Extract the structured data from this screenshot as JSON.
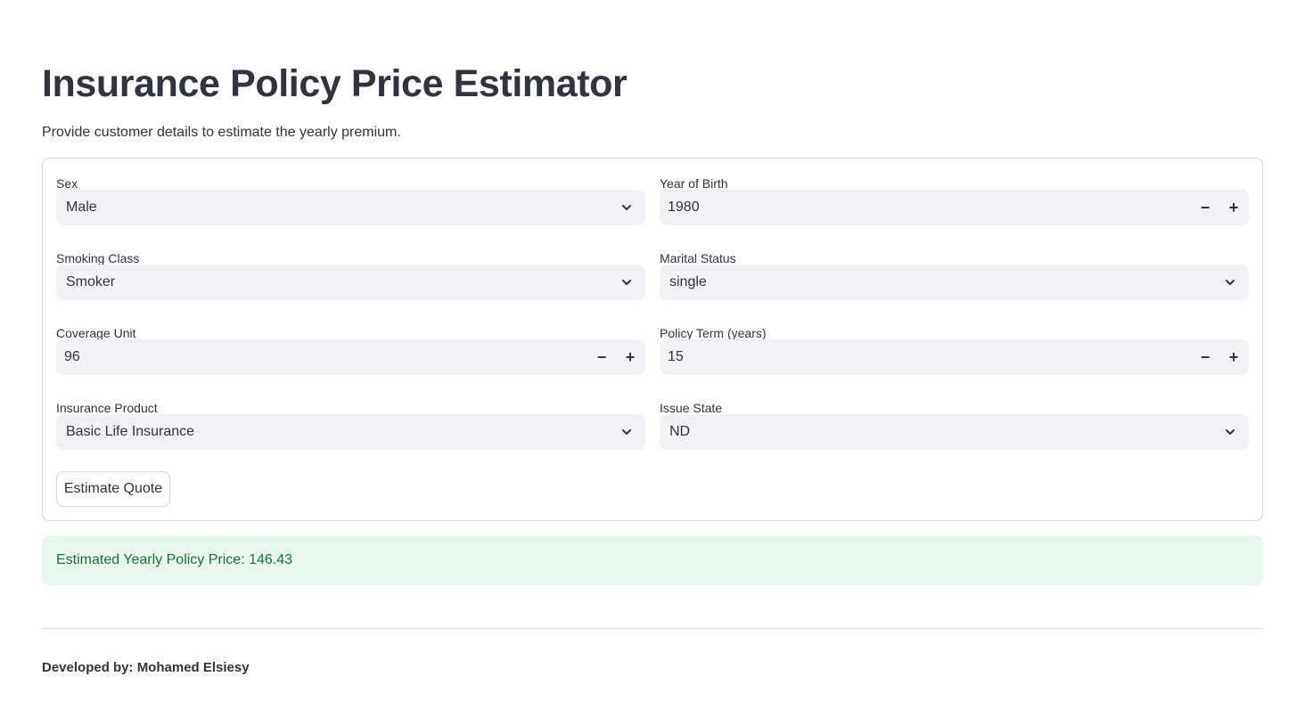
{
  "header": {
    "title": "Insurance Policy Price Estimator",
    "subtitle": "Provide customer details to estimate the yearly premium."
  },
  "form": {
    "sex": {
      "label": "Sex",
      "value": "Male"
    },
    "year_of_birth": {
      "label": "Year of Birth",
      "value": "1980",
      "decrement": "−",
      "increment": "+"
    },
    "smoking_class": {
      "label": "Smoking Class",
      "value": "Smoker"
    },
    "marital_status": {
      "label": "Marital Status",
      "value": "single"
    },
    "coverage_unit": {
      "label": "Coverage Unit",
      "value": "96",
      "decrement": "−",
      "increment": "+"
    },
    "policy_term": {
      "label": "Policy Term (years)",
      "value": "15",
      "decrement": "−",
      "increment": "+"
    },
    "insurance_product": {
      "label": "Insurance Product",
      "value": "Basic Life Insurance"
    },
    "issue_state": {
      "label": "Issue State",
      "value": "ND"
    },
    "submit_label": "Estimate Quote"
  },
  "result": {
    "text": "Estimated Yearly Policy Price: 146.43"
  },
  "footer": {
    "text": "Developed by: Mohamed Elsiesy"
  },
  "colors": {
    "text": "#31333f",
    "input_bg": "#f0f2f6",
    "border": "#d6d6d9",
    "success_bg": "#e8f8ee",
    "success_text": "#177233"
  },
  "icons": {
    "select_indicator": "chevron-down-icon",
    "decrement": "minus-icon",
    "increment": "plus-icon"
  }
}
